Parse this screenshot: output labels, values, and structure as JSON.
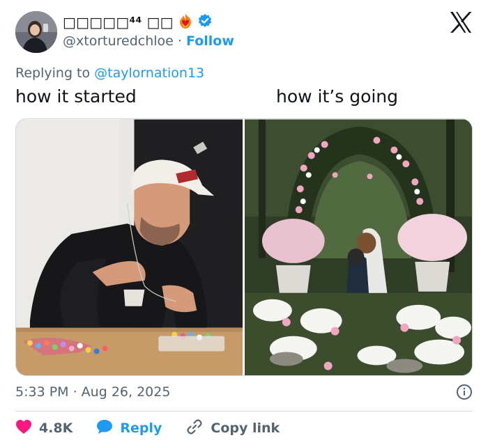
{
  "author": {
    "display_name": "□□□□□⁴⁴ □□",
    "handle": "@xtorturedchloe",
    "separator": "·",
    "follow_label": "Follow"
  },
  "reply_context": {
    "prefix": "Replying to ",
    "mention": "@taylornation13"
  },
  "captions": {
    "left": "how it started",
    "right": "how it’s going"
  },
  "timestamp": "5:33 PM · Aug 26, 2025",
  "actions": {
    "like_count": "4.8K",
    "reply_label": "Reply",
    "copy_label": "Copy link"
  },
  "colors": {
    "accent": "#1d9bf0",
    "like": "#f91880",
    "muted": "#536471",
    "text": "#0f1419"
  },
  "icons": {
    "verified": "verified-badge-icon",
    "logo": "x-logo-icon",
    "like": "heart-icon",
    "reply": "speech-bubble-icon",
    "copy": "link-icon",
    "info": "info-icon",
    "emoji": "heart-on-fire-icon"
  }
}
